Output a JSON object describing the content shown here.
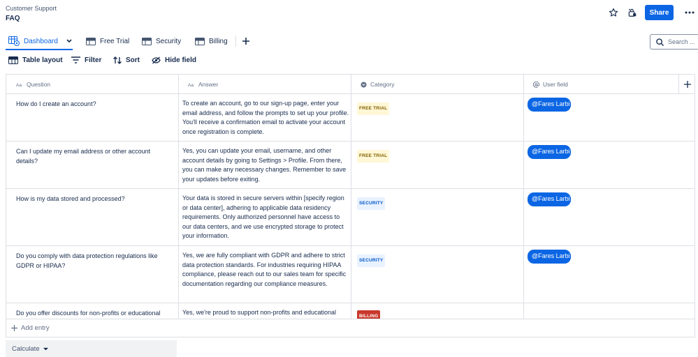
{
  "header": {
    "breadcrumb": "Customer Support",
    "title": "FAQ",
    "share_label": "Share"
  },
  "tabs": [
    {
      "label": "Dashboard",
      "active": true
    },
    {
      "label": "Free Trial",
      "active": false
    },
    {
      "label": "Security",
      "active": false
    },
    {
      "label": "Billing",
      "active": false
    }
  ],
  "search": {
    "placeholder": "Search ..."
  },
  "toolbar": {
    "table_layout": "Table layout",
    "filter": "Filter",
    "sort": "Sort",
    "hide_field": "Hide field"
  },
  "columns": {
    "question": "Question",
    "answer": "Answer",
    "category": "Category",
    "user_field": "User field"
  },
  "rows": [
    {
      "question": "How do I create an account?",
      "answer": "To create an account, go to our sign-up page, enter your email address, and follow the prompts to set up your profile. You'll receive a confirmation email to activate your account once registration is complete.",
      "category": "FREE TRIAL",
      "user": "@Fares Larbi"
    },
    {
      "question": "Can I update my email address or other account details?",
      "answer": "Yes, you can update your email, username, and other account details by going to Settings > Profile. From there, you can make any necessary changes. Remember to save your updates before exiting.",
      "category": "FREE TRIAL",
      "user": "@Fares Larbi"
    },
    {
      "question": "How is my data stored and processed?",
      "answer": "Your data is stored in secure servers within [specify region or data center], adhering to applicable data residency requirements. Only authorized personnel have access to our data centers, and we use encrypted storage to protect your information.",
      "category": "SECURITY",
      "user": "@Fares Larbi"
    },
    {
      "question": "Do you comply with data protection regulations like GDPR or HIPAA?",
      "answer": "Yes, we are fully compliant with GDPR and adhere to strict data protection standards. For industries requiring HIPAA compliance, please reach out to our sales team for specific documentation regarding our compliance measures.",
      "category": "SECURITY",
      "user": "@Fares Larbi"
    },
    {
      "question": "Do you offer discounts for non-profits or educational",
      "answer": "Yes, we're proud to support non-profits and educational",
      "category": "BILLING",
      "user": ""
    }
  ],
  "footer": {
    "add_entry": "Add entry",
    "calculate": "Calculate"
  },
  "colors": {
    "accent": "#0c66e4",
    "free_trial_bg": "#fff7d6",
    "security_bg": "#e9f2ff",
    "billing_bg": "#c9372c"
  }
}
